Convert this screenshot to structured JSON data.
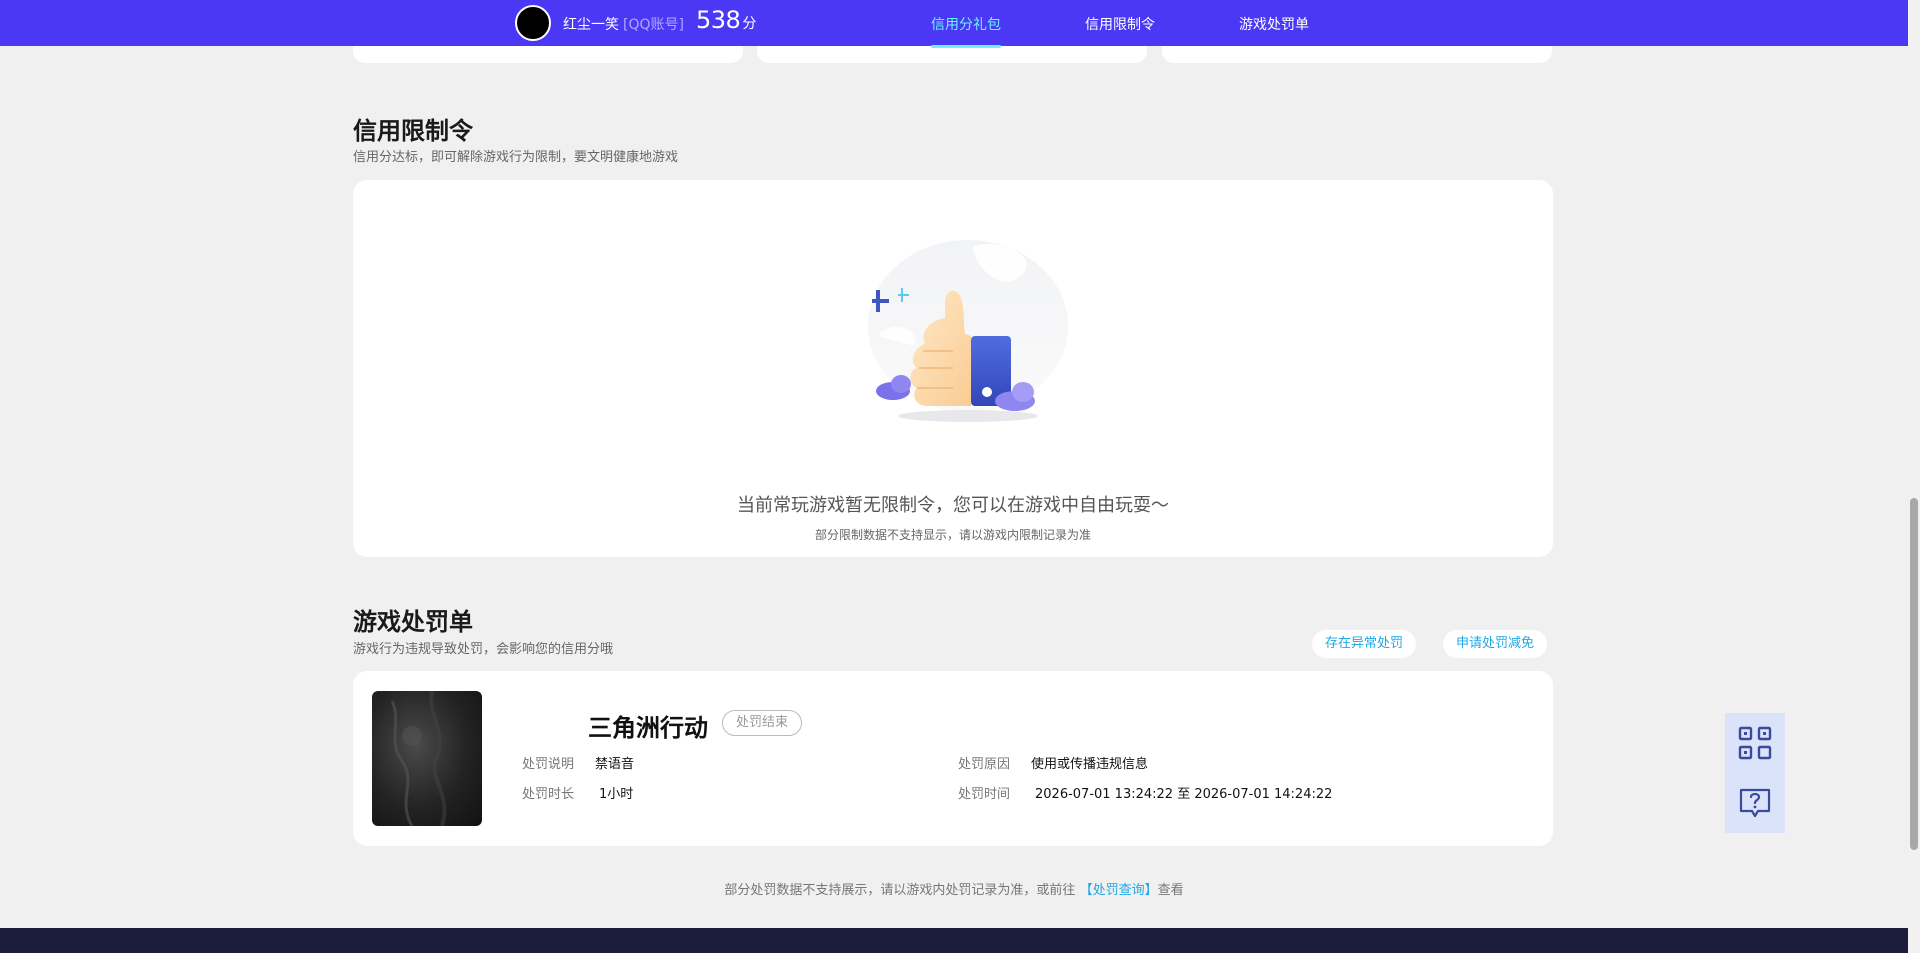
{
  "header": {
    "user_name": "红尘一笑",
    "account_type": "[QQ账号]",
    "score": "538",
    "score_unit": "分",
    "tabs": [
      {
        "label": "信用分礼包",
        "active": true
      },
      {
        "label": "信用限制令",
        "active": false
      },
      {
        "label": "游戏处罚单",
        "active": false
      }
    ]
  },
  "restriction_section": {
    "title": "信用限制令",
    "subtitle": "信用分达标，即可解除游戏行为限制，要文明健康地游戏",
    "empty_message": "当前常玩游戏暂无限制令，您可以在游戏中自由玩耍～",
    "empty_note": "部分限制数据不支持显示，请以游戏内限制记录为准"
  },
  "penalty_section": {
    "title": "游戏处罚单",
    "subtitle": "游戏行为违规导致处罚，会影响您的信用分哦",
    "btn_abnormal": "存在异常处罚",
    "btn_apply": "申请处罚减免",
    "record": {
      "game_name": "三角洲行动",
      "status": "处罚结束",
      "desc_label": "处罚说明",
      "desc_value": "禁语音",
      "duration_label": "处罚时长",
      "duration_value": "1小时",
      "reason_label": "处罚原因",
      "reason_value": "使用或传播违规信息",
      "time_label": "处罚时间",
      "time_value": "2026-07-01 13:24:22 至 2026-07-01 14:24:22"
    }
  },
  "footer": {
    "note_prefix": "部分处罚数据不支持展示，请以游戏内处罚记录为准，或前往",
    "note_link": "【处罚查询】",
    "note_suffix": "查看"
  },
  "float_buttons": {
    "qr_icon": "qr-code-icon",
    "feedback_icon": "help-chat-icon"
  },
  "colors": {
    "header_bg": "#4a38f5",
    "active_tab": "#6ef1ff",
    "link": "#1fa8e6",
    "footer_bg": "#1c1c3c"
  }
}
